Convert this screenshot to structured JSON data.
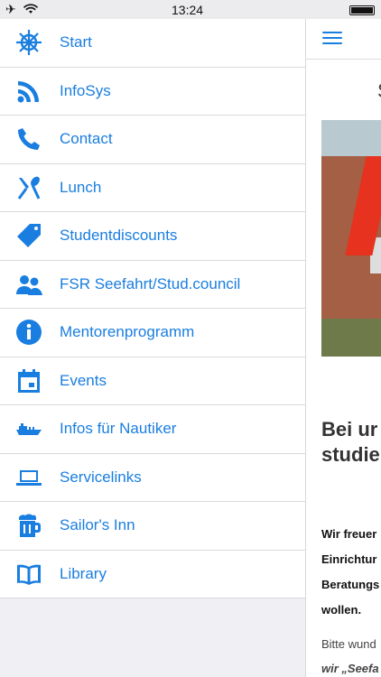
{
  "status": {
    "time": "13:24"
  },
  "menu": [
    {
      "label": "Start",
      "icon": "ships-wheel-icon"
    },
    {
      "label": "InfoSys",
      "icon": "rss-icon"
    },
    {
      "label": "Contact",
      "icon": "phone-icon"
    },
    {
      "label": "Lunch",
      "icon": "fork-spoon-icon"
    },
    {
      "label": "Studentdiscounts",
      "icon": "tag-icon"
    },
    {
      "label": "FSR Seefahrt/Stud.council",
      "icon": "people-icon"
    },
    {
      "label": "Mentorenprogramm",
      "icon": "info-icon"
    },
    {
      "label": "Events",
      "icon": "calendar-icon"
    },
    {
      "label": "Infos für Nautiker",
      "icon": "ship-icon"
    },
    {
      "label": "Servicelinks",
      "icon": "laptop-icon"
    },
    {
      "label": "Sailor's Inn",
      "icon": "beer-mug-icon"
    },
    {
      "label": "Library",
      "icon": "book-icon"
    }
  ],
  "content": {
    "title_partial": "S",
    "heading_lines": [
      "Bei ur",
      "studie"
    ],
    "paragraph_lines": [
      "Wir freuer",
      "Einrichtur",
      "Beratungs",
      "wollen."
    ],
    "paragraph2_lines": [
      "Bitte wund",
      "wir „Seefa"
    ]
  },
  "colors": {
    "accent": "#1a7ee0"
  }
}
